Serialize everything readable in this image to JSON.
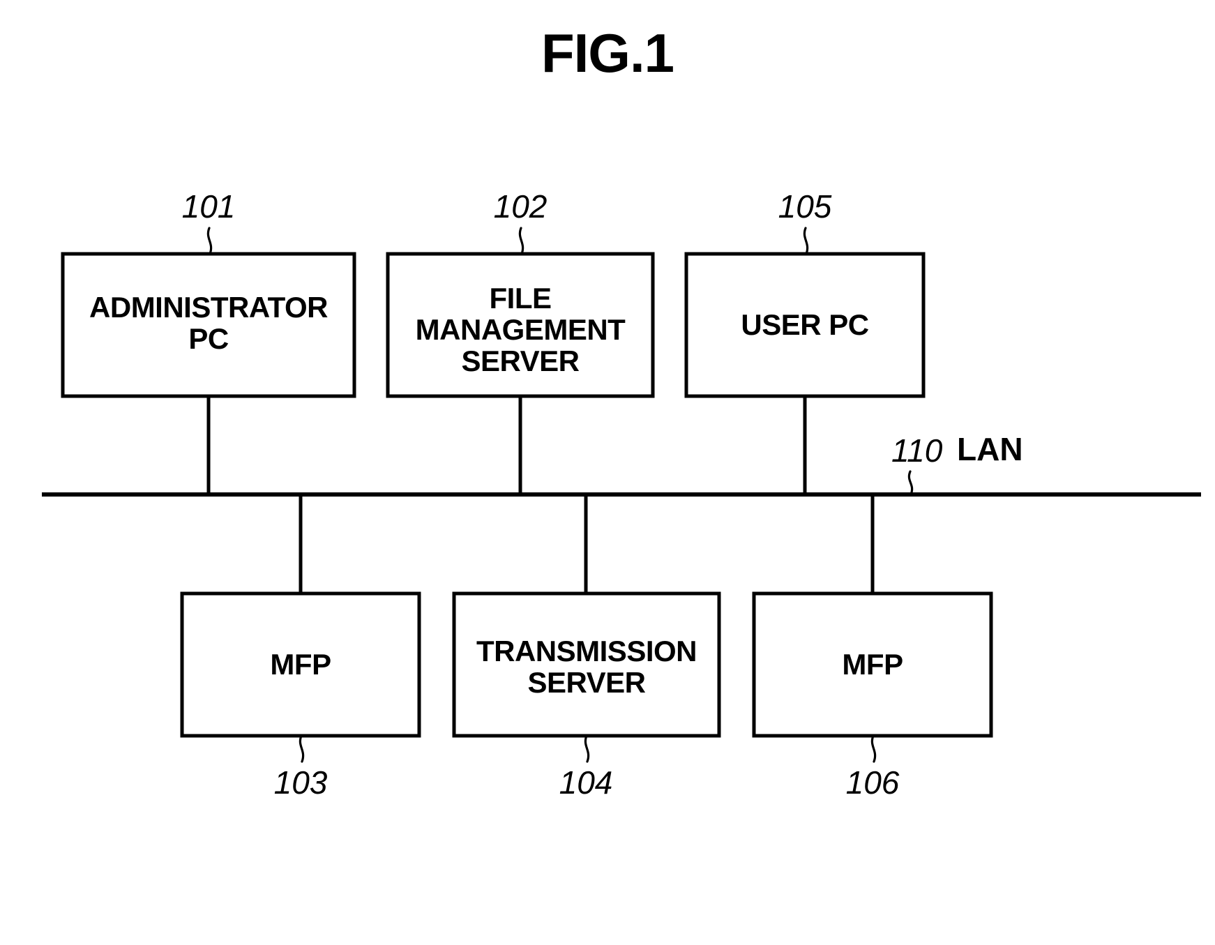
{
  "figure": {
    "title": "FIG.1",
    "type": "patent-system-block-diagram"
  },
  "nodes": {
    "administrator_pc": {
      "ref": "101",
      "label_line1": "ADMINISTRATOR",
      "label_line2": "PC"
    },
    "file_management_server": {
      "ref": "102",
      "label_line1": "FILE",
      "label_line2": "MANAGEMENT",
      "label_line3": "SERVER"
    },
    "user_pc": {
      "ref": "105",
      "label_line1": "USER PC"
    },
    "mfp_left": {
      "ref": "103",
      "label_line1": "MFP"
    },
    "transmission_server": {
      "ref": "104",
      "label_line1": "TRANSMISSION",
      "label_line2": "SERVER"
    },
    "mfp_right": {
      "ref": "106",
      "label_line1": "MFP"
    }
  },
  "network": {
    "ref": "110",
    "name": "LAN"
  },
  "colors": {
    "ink": "#000000",
    "paper": "#ffffff"
  }
}
